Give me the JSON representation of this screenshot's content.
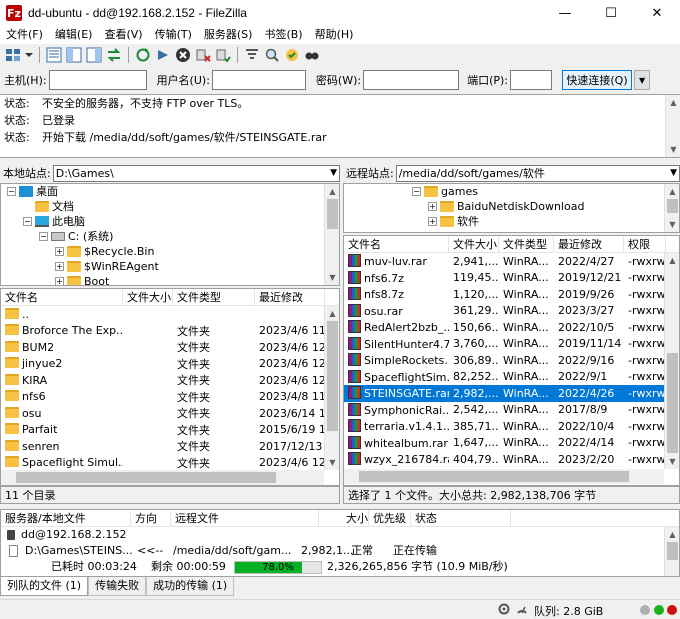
{
  "window": {
    "title": "dd-ubuntu - dd@192.168.2.152 - FileZilla",
    "app_icon": "Fz",
    "minimize": "—",
    "maximize": "☐",
    "close": "✕"
  },
  "menu": [
    "文件(F)",
    "编辑(E)",
    "查看(V)",
    "传输(T)",
    "服务器(S)",
    "书签(B)",
    "帮助(H)"
  ],
  "toolbar_icons": [
    "site-manager-icon",
    "dropdown-icon",
    "toggle-log-icon",
    "toggle-local-tree-icon",
    "toggle-remote-tree-icon",
    "toggle-queue-icon",
    "refresh-icon",
    "process-queue-icon",
    "cancel-icon",
    "disconnect-icon",
    "reconnect-icon",
    "filter-icon",
    "compare-icon",
    "sync-browse-icon",
    "search-icon"
  ],
  "quickconnect": {
    "host_label": "主机(H):",
    "user_label": "用户名(U):",
    "pass_label": "密码(W):",
    "port_label": "端口(P):",
    "connect_label": "快速连接(Q)",
    "dropdown": "▼"
  },
  "log": [
    {
      "k": "状态:",
      "v": "不安全的服务器，不支持 FTP over TLS。"
    },
    {
      "k": "状态:",
      "v": "已登录"
    },
    {
      "k": "状态:",
      "v": "开始下载 /media/dd/soft/games/软件/STEINSGATE.rar"
    }
  ],
  "local": {
    "label": "本地站点:",
    "path": "D:\\Games\\",
    "tree": [
      {
        "indent": 6,
        "exp": "−",
        "icon": "desktop",
        "text": "桌面"
      },
      {
        "indent": 22,
        "exp": "",
        "icon": "folder",
        "text": "文档"
      },
      {
        "indent": 22,
        "exp": "−",
        "icon": "computer",
        "text": "此电脑"
      },
      {
        "indent": 38,
        "exp": "−",
        "icon": "drive",
        "text": "C: (系统)"
      },
      {
        "indent": 54,
        "exp": "+",
        "icon": "folder",
        "text": "$Recycle.Bin"
      },
      {
        "indent": 54,
        "exp": "+",
        "icon": "folder",
        "text": "$WinREAgent"
      },
      {
        "indent": 54,
        "exp": "+",
        "icon": "folder",
        "text": "Boot"
      }
    ],
    "columns": [
      "文件名",
      "文件大小",
      "文件类型",
      "最近修改"
    ],
    "rows": [
      {
        "name": "..",
        "size": "",
        "type": "",
        "date": ""
      },
      {
        "name": "Broforce The Exp...",
        "size": "",
        "type": "文件夹",
        "date": "2023/4/6 11:"
      },
      {
        "name": "BUM2",
        "size": "",
        "type": "文件夹",
        "date": "2023/4/6 12:"
      },
      {
        "name": "jinyue2",
        "size": "",
        "type": "文件夹",
        "date": "2023/4/6 12:"
      },
      {
        "name": "KIRA",
        "size": "",
        "type": "文件夹",
        "date": "2023/4/6 12:"
      },
      {
        "name": "nfs6",
        "size": "",
        "type": "文件夹",
        "date": "2023/4/8 11:"
      },
      {
        "name": "osu",
        "size": "",
        "type": "文件夹",
        "date": "2023/6/14 1:"
      },
      {
        "name": "Parfait",
        "size": "",
        "type": "文件夹",
        "date": "2015/6/19 1:"
      },
      {
        "name": "senren",
        "size": "",
        "type": "文件夹",
        "date": "2017/12/13 ."
      },
      {
        "name": "Spaceflight Simul...",
        "size": "",
        "type": "文件夹",
        "date": "2023/4/6 12:"
      }
    ],
    "status": "11 个目录"
  },
  "remote": {
    "label": "远程站点:",
    "path": "/media/dd/soft/games/软件",
    "tree": [
      {
        "indent": 68,
        "exp": "−",
        "text": "games"
      },
      {
        "indent": 84,
        "exp": "+",
        "text": "BaiduNetdiskDownload"
      },
      {
        "indent": 84,
        "exp": "+",
        "text": "软件"
      }
    ],
    "columns": [
      "文件名",
      "文件大小",
      "文件类型",
      "最近修改",
      "权限"
    ],
    "rows": [
      {
        "name": "muv-luv.rar",
        "size": "2,941,...",
        "type": "WinRA...",
        "date": "2022/4/27",
        "perm": "-rwxrw.",
        "sel": false
      },
      {
        "name": "nfs6.7z",
        "size": "119,45...",
        "type": "WinRA...",
        "date": "2019/12/21",
        "perm": "-rwxrw.",
        "sel": false
      },
      {
        "name": "nfs8.7z",
        "size": "1,120,...",
        "type": "WinRA...",
        "date": "2019/9/26",
        "perm": "-rwxrw.",
        "sel": false
      },
      {
        "name": "osu.rar",
        "size": "361,29...",
        "type": "WinRA...",
        "date": "2023/3/27",
        "perm": "-rwxrw.",
        "sel": false
      },
      {
        "name": "RedAlert2bzb_...",
        "size": "150,66...",
        "type": "WinRA...",
        "date": "2022/10/5",
        "perm": "-rwxrw.",
        "sel": false
      },
      {
        "name": "SilentHunter4.7z",
        "size": "3,760,...",
        "type": "WinRA...",
        "date": "2019/11/14",
        "perm": "-rwxrw.",
        "sel": false
      },
      {
        "name": "SimpleRockets...",
        "size": "306,89...",
        "type": "WinRA...",
        "date": "2022/9/16",
        "perm": "-rwxrw.",
        "sel": false
      },
      {
        "name": "SpaceflightSim...",
        "size": "82,252...",
        "type": "WinRA...",
        "date": "2022/9/1",
        "perm": "-rwxrw.",
        "sel": false
      },
      {
        "name": "STEINSGATE.rar",
        "size": "2,982,...",
        "type": "WinRA...",
        "date": "2022/4/26",
        "perm": "-rwxrw.",
        "sel": true
      },
      {
        "name": "SymphonicRai...",
        "size": "2,542,...",
        "type": "WinRA...",
        "date": "2017/8/9",
        "perm": "-rwxrw.",
        "sel": false
      },
      {
        "name": "terraria.v1.4.1...",
        "size": "385,71...",
        "type": "WinRA...",
        "date": "2022/10/4",
        "perm": "-rwxrw.",
        "sel": false
      },
      {
        "name": "whitealbum.rar",
        "size": "1,647,...",
        "type": "WinRA...",
        "date": "2022/4/14",
        "perm": "-rwxrw.",
        "sel": false
      },
      {
        "name": "wzyx_216784.rar",
        "size": "404,79...",
        "type": "WinRA...",
        "date": "2023/2/20",
        "perm": "-rwxrw.",
        "sel": false
      }
    ],
    "status": "选择了 1 个文件。大小总共: 2,982,138,706 字节"
  },
  "queue": {
    "columns": [
      "服务器/本地文件",
      "方向",
      "远程文件",
      "大小",
      "优先级",
      "状态"
    ],
    "server": "dd@192.168.2.152",
    "local_file": "D:\\Games\\STEINS...",
    "direction": "<<--",
    "remote_file": "/media/dd/soft/gam...",
    "size": "2,982,1...",
    "priority": "正常",
    "state": "正在传输",
    "elapsed": "已耗时 00:03:24",
    "remaining": "剩余 00:00:59",
    "progress_text": "78.0%",
    "progress": 0.78,
    "transferred": "2,326,265,856 字节 (10.9 MiB/秒)"
  },
  "tabs": [
    "列队的文件 (1)",
    "传输失败",
    "成功的传输 (1)"
  ],
  "bottom": {
    "queue": "队列: 2.8 GiB"
  }
}
